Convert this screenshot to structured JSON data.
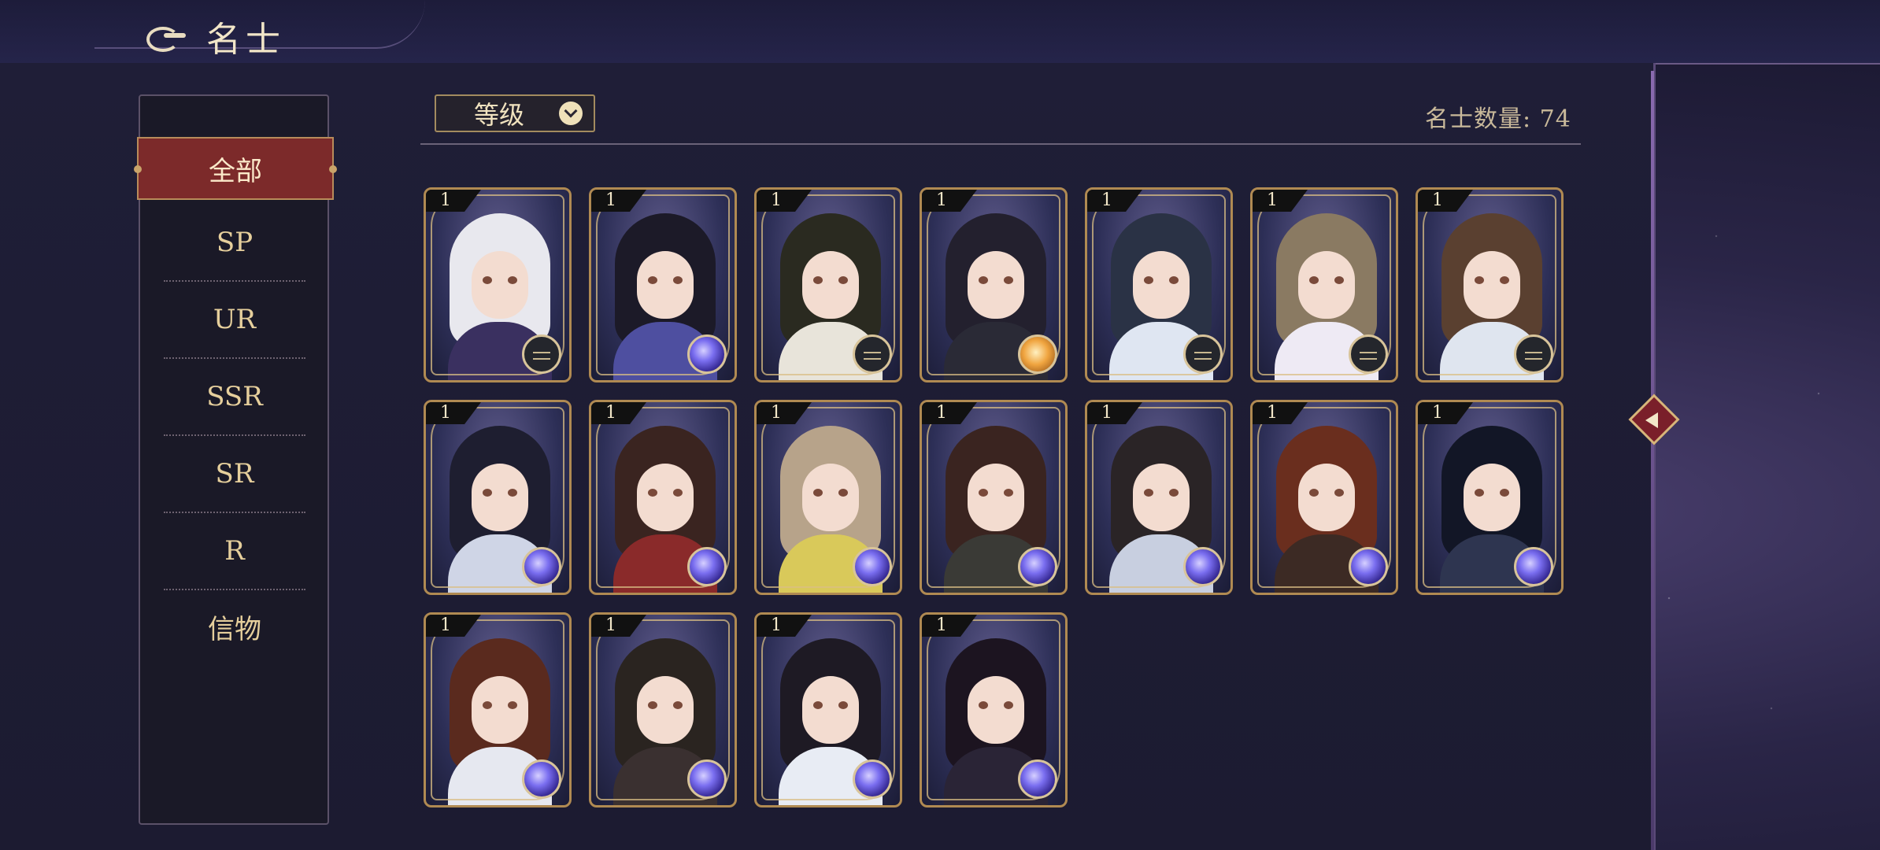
{
  "header": {
    "title": "名士"
  },
  "sidebar": {
    "tabs": [
      {
        "label": "全部",
        "active": true
      },
      {
        "label": "SP"
      },
      {
        "label": "UR"
      },
      {
        "label": "SSR"
      },
      {
        "label": "SR"
      },
      {
        "label": "R"
      },
      {
        "label": "信物"
      }
    ]
  },
  "toolbar": {
    "sort_label": "等级",
    "count_text": "名士数量: 74"
  },
  "colors": {
    "accent_gold": "#b08a52",
    "active_tab": "#7c2a2a",
    "background": "#1c1b31"
  },
  "cards": [
    {
      "level": "1",
      "emblem": "compass",
      "hair": "#e8e8ee",
      "robe": "#3a3060"
    },
    {
      "level": "1",
      "emblem": "orb",
      "hair": "#1c1a28",
      "robe": "#4e4fa0"
    },
    {
      "level": "1",
      "emblem": "compass",
      "hair": "#2a2a20",
      "robe": "#e8e4da"
    },
    {
      "level": "1",
      "emblem": "sun",
      "hair": "#23202e",
      "robe": "#2a2a36"
    },
    {
      "level": "1",
      "emblem": "compass",
      "hair": "#2a3245",
      "robe": "#dfe6f2"
    },
    {
      "level": "1",
      "emblem": "compass",
      "hair": "#8a7a62",
      "robe": "#eeeaf4"
    },
    {
      "level": "1",
      "emblem": "compass",
      "hair": "#5a4030",
      "robe": "#dfe5ef"
    },
    {
      "level": "1",
      "emblem": "orb",
      "hair": "#1e1e30",
      "robe": "#cfd5e6"
    },
    {
      "level": "1",
      "emblem": "orb",
      "hair": "#3a2420",
      "robe": "#8a2a2a"
    },
    {
      "level": "1",
      "emblem": "orb",
      "hair": "#b7a38a",
      "robe": "#d9c95a"
    },
    {
      "level": "1",
      "emblem": "orb",
      "hair": "#3a2420",
      "robe": "#3a3a36"
    },
    {
      "level": "1",
      "emblem": "orb",
      "hair": "#2a2426",
      "robe": "#c8cfe0"
    },
    {
      "level": "1",
      "emblem": "orb",
      "hair": "#6a2e1e",
      "robe": "#3c2a24"
    },
    {
      "level": "1",
      "emblem": "orb",
      "hair": "#121626",
      "robe": "#2e3550"
    },
    {
      "level": "1",
      "emblem": "orb",
      "hair": "#5a2a1e",
      "robe": "#e6e8f0"
    },
    {
      "level": "1",
      "emblem": "orb",
      "hair": "#2a2420",
      "robe": "#3a3030"
    },
    {
      "level": "1",
      "emblem": "orb",
      "hair": "#1e1a24",
      "robe": "#e8ecf4"
    },
    {
      "level": "1",
      "emblem": "orb",
      "hair": "#1c1420",
      "robe": "#2a2436"
    }
  ]
}
